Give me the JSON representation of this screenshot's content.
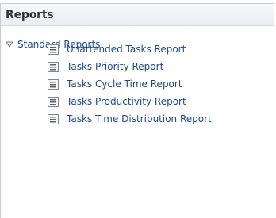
{
  "panel": {
    "title": "Reports"
  },
  "tree": {
    "root_label": "Standard Reports",
    "root_icon": "disclosure-expanded-icon",
    "items": [
      {
        "label": "Unattended Tasks Report",
        "icon": "report-icon"
      },
      {
        "label": "Tasks Priority Report",
        "icon": "report-icon"
      },
      {
        "label": "Tasks Cycle Time Report",
        "icon": "report-icon"
      },
      {
        "label": "Tasks Productivity Report",
        "icon": "report-icon"
      },
      {
        "label": "Tasks Time Distribution Report",
        "icon": "report-icon"
      }
    ]
  },
  "colors": {
    "link": "#1d4a8c",
    "title": "#333333",
    "header_gradient_top": "#f7f9fb",
    "header_gradient_bottom": "#e9eef3",
    "border": "#c4cbd4"
  }
}
